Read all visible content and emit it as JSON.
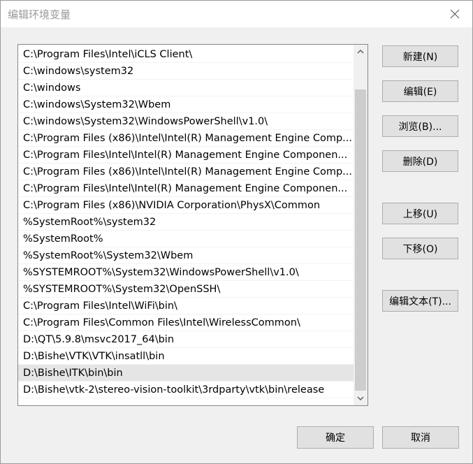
{
  "window": {
    "title": "编辑环境变量",
    "close_icon": "close-icon"
  },
  "path_list": {
    "selected_index": 19,
    "items": [
      "C:\\Program Files\\Intel\\iCLS Client\\",
      "C:\\windows\\system32",
      "C:\\windows",
      "C:\\windows\\System32\\Wbem",
      "C:\\windows\\System32\\WindowsPowerShell\\v1.0\\",
      "C:\\Program Files (x86)\\Intel\\Intel(R) Management Engine Comp...",
      "C:\\Program Files\\Intel\\Intel(R) Management Engine Componen...",
      "C:\\Program Files (x86)\\Intel\\Intel(R) Management Engine Comp...",
      "C:\\Program Files\\Intel\\Intel(R) Management Engine Componen...",
      "C:\\Program Files (x86)\\NVIDIA Corporation\\PhysX\\Common",
      "%SystemRoot%\\system32",
      "%SystemRoot%",
      "%SystemRoot%\\System32\\Wbem",
      "%SYSTEMROOT%\\System32\\WindowsPowerShell\\v1.0\\",
      "%SYSTEMROOT%\\System32\\OpenSSH\\",
      "C:\\Program Files\\Intel\\WiFi\\bin\\",
      "C:\\Program Files\\Common Files\\Intel\\WirelessCommon\\",
      "D:\\QT\\5.9.8\\msvc2017_64\\bin",
      "D:\\Bishe\\VTK\\VTK\\insatll\\bin",
      "D:\\Bishe\\ITK\\bin\\bin",
      "D:\\Bishe\\vtk-2\\stereo-vision-toolkit\\3rdparty\\vtk\\bin\\release"
    ]
  },
  "buttons": {
    "new": "新建(N)",
    "edit": "编辑(E)",
    "browse": "浏览(B)...",
    "delete": "删除(D)",
    "move_up": "上移(U)",
    "move_down": "下移(O)",
    "edit_text": "编辑文本(T)...",
    "ok": "确定",
    "cancel": "取消"
  },
  "scrollbar": {
    "up_icon": "scroll-up-arrow-icon",
    "down_icon": "scroll-down-arrow-icon"
  }
}
